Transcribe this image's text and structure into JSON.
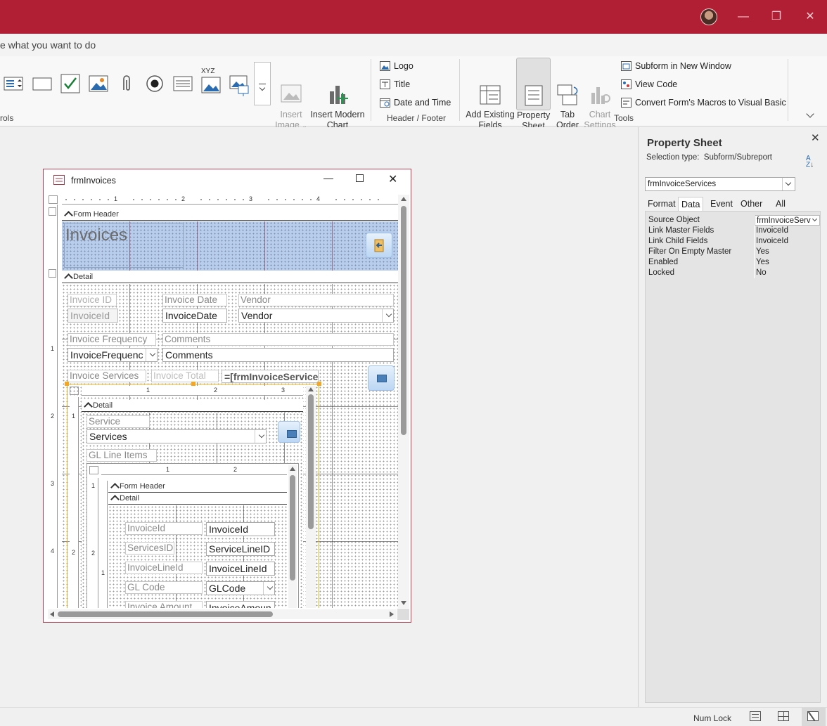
{
  "tellme": {
    "text": "e what you want to do"
  },
  "ribbon": {
    "controls_group_label": "rols",
    "insert_image": "Insert\nImage",
    "insert_chart": "Insert Modern\nChart",
    "logo": "Logo",
    "title": "Title",
    "date_time": "Date and Time",
    "header_footer_group": "Header / Footer",
    "add_existing": "Add Existing\nFields",
    "property_sheet": "Property\nSheet",
    "tab_order": "Tab\nOrder",
    "chart_settings": "Chart\nSettings",
    "subform_new_window": "Subform in New Window",
    "view_code": "View Code",
    "convert_macros": "Convert Form's Macros to Visual Basic",
    "tools_group": "Tools",
    "xyz": "XYZ"
  },
  "form_window": {
    "title": "frmInvoices",
    "ruler_top": [
      "1",
      "2",
      "3",
      "4"
    ],
    "ruler_left": [
      "1",
      "2",
      "3",
      "4"
    ],
    "form_header": "Form Header",
    "detail": "Detail",
    "heading": "Invoices",
    "labels": {
      "invoice_id": "Invoice ID",
      "invoice_date": "Invoice Date",
      "vendor": "Vendor",
      "invoice_frequency": "Invoice Frequency",
      "comments": "Comments",
      "invoice_services": "Invoice Services",
      "invoice_total": "Invoice Total"
    },
    "fields": {
      "invoice_id": "InvoiceId",
      "invoice_date": "InvoiceDate",
      "vendor": "Vendor",
      "invoice_frequency": "InvoiceFrequenc",
      "comments": "Comments",
      "invoice_total": "=[frmInvoiceService"
    },
    "sub1": {
      "ruler_top": [
        "1",
        "2",
        "3"
      ],
      "detail": "Detail",
      "service_label": "Service",
      "service_combo": "Services",
      "gl_line_items": "GL Line Items",
      "ruler_left": [
        "1",
        "2"
      ]
    },
    "sub2": {
      "ruler_top": [
        "1",
        "2"
      ],
      "ruler_left": [
        "1",
        "2",
        "1"
      ],
      "form_header": "Form Header",
      "detail": "Detail",
      "rows": [
        {
          "label": "InvoiceId",
          "value": "InvoiceId"
        },
        {
          "label": "ServicesID",
          "value": "ServiceLineID"
        },
        {
          "label": "InvoiceLineId",
          "value": "InvoiceLineId"
        },
        {
          "label": "GL Code",
          "value": "GLCode"
        },
        {
          "label": "Invoice Amount",
          "value": "InvoiceAmoun"
        }
      ]
    }
  },
  "property_sheet": {
    "title": "Property Sheet",
    "selection_type_label": "Selection type:",
    "selection_type_value": "Subform/Subreport",
    "object_select": "frmInvoiceServices",
    "tabs": [
      "Format",
      "Data",
      "Event",
      "Other",
      "All"
    ],
    "active_tab": "Data",
    "properties": [
      {
        "name": "Source Object",
        "value": "frmInvoiceServ"
      },
      {
        "name": "Link Master Fields",
        "value": "InvoiceId"
      },
      {
        "name": "Link Child Fields",
        "value": "InvoiceId"
      },
      {
        "name": "Filter On Empty Master",
        "value": "Yes"
      },
      {
        "name": "Enabled",
        "value": "Yes"
      },
      {
        "name": "Locked",
        "value": "No"
      }
    ]
  },
  "status": {
    "num_lock": "Num Lock"
  },
  "colors": {
    "title_bar": "#b01f33",
    "header_band": "#b7cdeb",
    "selection": "#f5a623"
  }
}
